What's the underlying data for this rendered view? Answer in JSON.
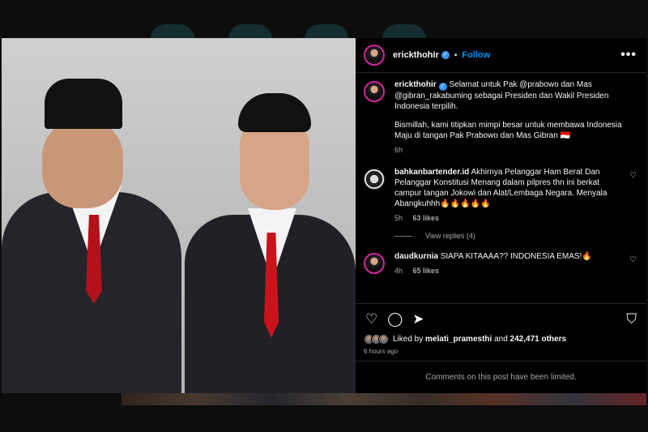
{
  "post": {
    "username": "erickthohir",
    "dot": "•",
    "follow": "Follow",
    "more": "•••",
    "caption_p1": "Selamat untuk Pak @prabowo dan Mas @gibran_rakabuming sebagai Presiden dan Wakil Presiden Indonesia terpilih.",
    "caption_p2": "Bismillah, kami titipkan mimpi besar untuk membawa Indonesia Maju di tangan Pak Prabowo dan Mas Gibran 🇮🇩",
    "caption_time": "6h"
  },
  "comments": [
    {
      "username": "bahkanbartender.id",
      "text": "Akhirnya Pelanggar Ham Berat Dan Pelanggar Konstitusi Menang dalam pilpres thn ini berkat campur tangan Jokowi dan Alat/Lembaga Negara. Menyala Abangkuhhh🔥🔥🔥🔥🔥",
      "time": "5h",
      "likes": "63 likes",
      "replies": "View replies (4)"
    },
    {
      "username": "daudkurnia",
      "text": "SIAPA KITAAAA?? INDONESIA EMAS!🔥",
      "time": "4h",
      "likes": "65 likes"
    }
  ],
  "likes_bar": {
    "prefix": "Liked by",
    "user": "melati_pramesthi",
    "and": "and",
    "count": "242,471 others",
    "time": "6 hours ago"
  },
  "footer": {
    "limited": "Comments on this post have been limited."
  },
  "icons": {
    "heart": "♡",
    "comment": "◯",
    "share": "➤",
    "save": "⛉",
    "verified": "✓"
  },
  "colors": {
    "accent": "#0095f6",
    "verified": "#3897f0",
    "background": "#000000"
  }
}
